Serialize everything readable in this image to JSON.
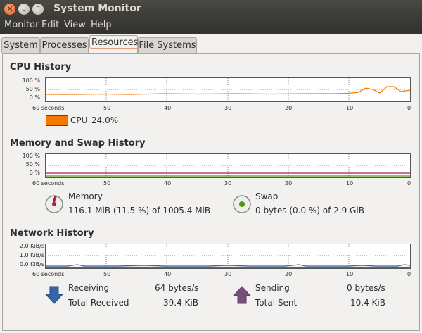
{
  "window": {
    "title": "System Monitor"
  },
  "menu": [
    "Monitor",
    "Edit",
    "View",
    "Help"
  ],
  "tabs": [
    "System",
    "Processes",
    "Resources",
    "File Systems"
  ],
  "x_labels": [
    "60 seconds",
    "50",
    "40",
    "30",
    "20",
    "10",
    "0"
  ],
  "cpu": {
    "title": "CPU History",
    "y_labels": [
      "100 %",
      "50 %",
      "0 %"
    ],
    "legend_label": "CPU",
    "legend_value": "24.0%",
    "color": "#f57900"
  },
  "memory": {
    "title": "Memory and Swap History",
    "y_labels": [
      "100 %",
      "50 %",
      "0 %"
    ],
    "mem_label": "Memory",
    "mem_value": "116.1 MiB (11.5 %) of 1005.4 MiB",
    "swap_label": "Swap",
    "swap_value": "0 bytes (0.0 %) of 2.9 GiB",
    "mem_color": "#ad1f4b",
    "swap_color": "#4e9a06"
  },
  "network": {
    "title": "Network History",
    "y_labels": [
      "2.0 KiB/s",
      "1.0 KiB/s",
      "0.0 KiB/s"
    ],
    "receiving_label": "Receiving",
    "receiving_value": "64 bytes/s",
    "total_received_label": "Total Received",
    "total_received_value": "39.4 KiB",
    "sending_label": "Sending",
    "sending_value": "0 bytes/s",
    "total_sent_label": "Total Sent",
    "total_sent_value": "10.4 KiB",
    "recv_color": "#3465a4",
    "send_color": "#75507b"
  }
}
